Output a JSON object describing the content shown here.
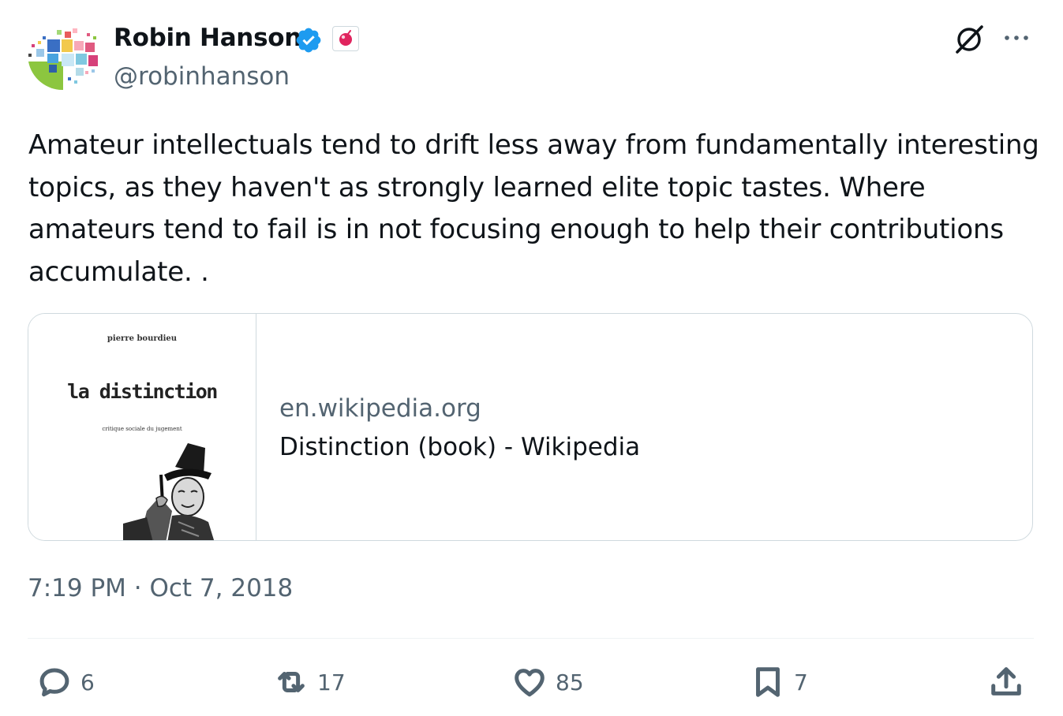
{
  "author": {
    "name": "Robin Hanson",
    "handle": "@robinhanson",
    "avatar_icon": "mosaic-avatar",
    "verified_icon": "verified-badge-icon",
    "affiliation_icon": "affiliation-badge-icon"
  },
  "tweet": {
    "text": "Amateur intellectuals tend to drift less away from fundamentally interesting topics, as they haven't as strongly learned elite topic tastes. Where amateurs tend to fail is in not focusing enough to help their contributions accumulate. ."
  },
  "card": {
    "book_author": "pierre bourdieu",
    "book_title": "la distinction",
    "book_subtitle": "critique sociale du jugement",
    "domain": "en.wikipedia.org",
    "title": "Distinction (book) - Wikipedia"
  },
  "meta": {
    "timestamp": "7:19 PM · Oct 7, 2018"
  },
  "actions": {
    "replies": "6",
    "reposts": "17",
    "likes": "85",
    "bookmarks": "7"
  },
  "colors": {
    "text": "#0f1419",
    "secondary": "#536471",
    "verified": "#1d9bf0",
    "border": "#cfd9de"
  }
}
